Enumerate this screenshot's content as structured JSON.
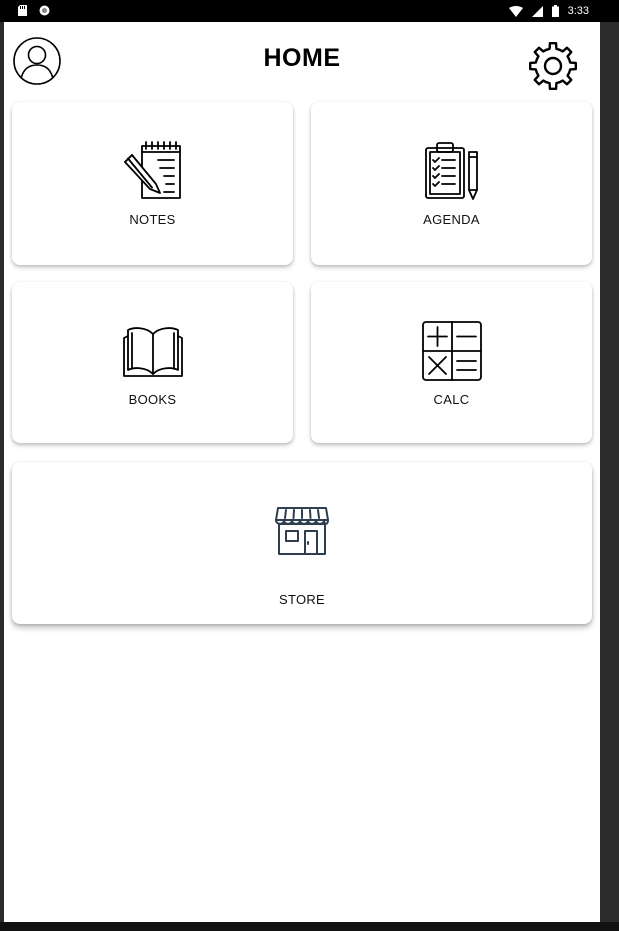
{
  "status_bar": {
    "time": "3:33",
    "icons": [
      "sd-card-icon",
      "circle-status-icon",
      "wifi-icon",
      "signal-icon",
      "battery-icon"
    ]
  },
  "header": {
    "title": "HOME",
    "avatar_icon": "user-avatar-icon",
    "settings_icon": "gear-icon"
  },
  "tiles": [
    {
      "label": "NOTES",
      "icon": "notepad-pencil-icon"
    },
    {
      "label": "AGENDA",
      "icon": "clipboard-checklist-icon"
    },
    {
      "label": "BOOKS",
      "icon": "open-book-icon"
    },
    {
      "label": "CALC",
      "icon": "calculator-icon"
    },
    {
      "label": "STORE",
      "icon": "storefront-icon"
    }
  ],
  "colors": {
    "background": "#ffffff",
    "text": "#000000",
    "store_icon": "#2f3e4e"
  }
}
